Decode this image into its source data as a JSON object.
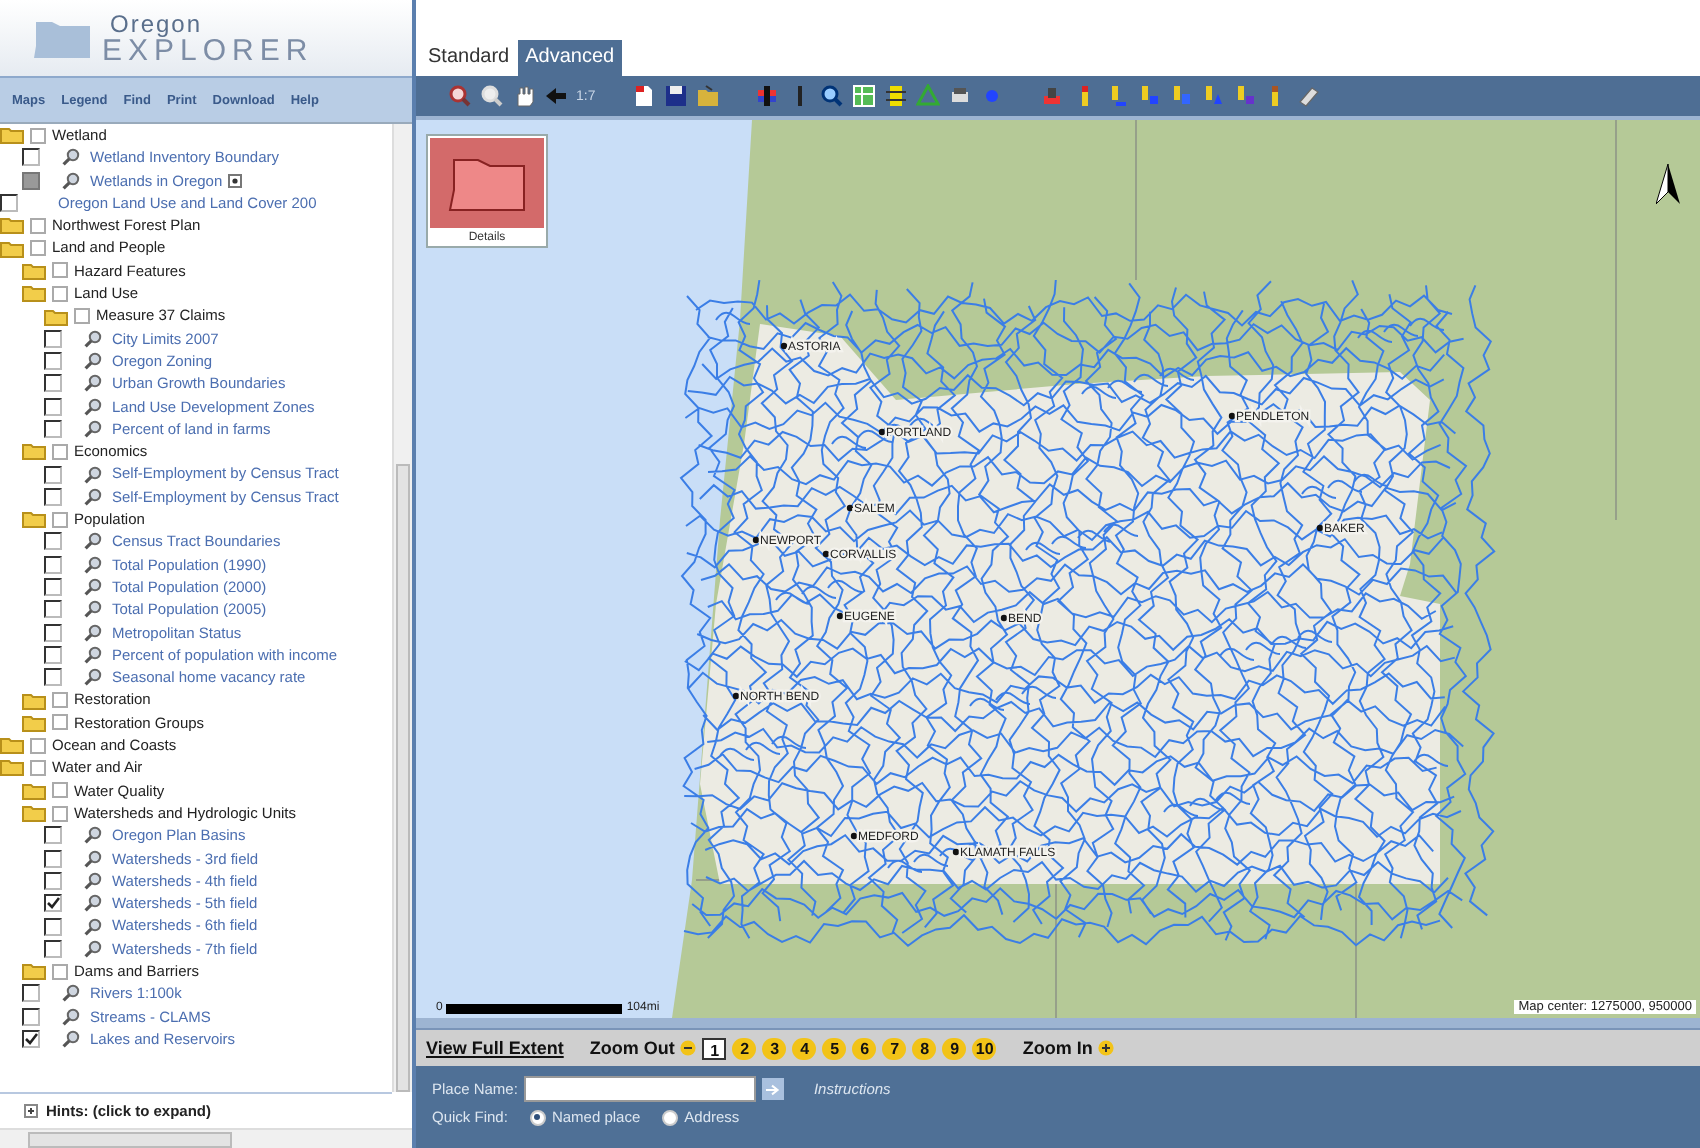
{
  "logo": {
    "line1": "Oregon",
    "line2": "EXPLORER"
  },
  "menu": [
    "Maps",
    "Legend",
    "Find",
    "Print",
    "Download",
    "Help"
  ],
  "tree": [
    {
      "kind": "folder",
      "label": "Wetland",
      "checked": false,
      "children": [
        {
          "kind": "layer",
          "label": "Wetland Inventory Boundary",
          "checked": false,
          "disabled": false
        },
        {
          "kind": "layer",
          "label": "Wetlands in Oregon",
          "checked": false,
          "disabled": true,
          "legend_button": true
        }
      ]
    },
    {
      "kind": "raster",
      "label": "Oregon Land Use and Land Cover 200",
      "checked": false,
      "disabled": false
    },
    {
      "kind": "folder",
      "label": "Northwest Forest Plan",
      "checked": false
    },
    {
      "kind": "folder",
      "label": "Land and People",
      "checked": false,
      "children": [
        {
          "kind": "folder",
          "label": "Hazard Features",
          "checked": false
        },
        {
          "kind": "folder",
          "label": "Land Use",
          "checked": false,
          "children": [
            {
              "kind": "folder",
              "label": "Measure 37 Claims",
              "checked": false
            },
            {
              "kind": "layer",
              "label": "City Limits 2007",
              "checked": false,
              "disabled": false
            },
            {
              "kind": "layer",
              "label": "Oregon Zoning",
              "checked": false,
              "disabled": false
            },
            {
              "kind": "layer",
              "label": "Urban Growth Boundaries",
              "checked": false,
              "disabled": false
            },
            {
              "kind": "layer",
              "label": "Land Use Development Zones",
              "checked": false,
              "disabled": false
            },
            {
              "kind": "layer",
              "label": "Percent of land in farms",
              "checked": false,
              "disabled": false
            }
          ]
        },
        {
          "kind": "folder",
          "label": "Economics",
          "checked": false,
          "children": [
            {
              "kind": "layer",
              "label": "Self-Employment by Census Tract",
              "checked": false,
              "disabled": false
            },
            {
              "kind": "layer",
              "label": "Self-Employment by Census Tract",
              "checked": false,
              "disabled": false
            }
          ]
        },
        {
          "kind": "folder",
          "label": "Population",
          "checked": false,
          "children": [
            {
              "kind": "layer",
              "label": "Census Tract Boundaries",
              "checked": false,
              "disabled": false
            },
            {
              "kind": "layer",
              "label": "Total Population (1990)",
              "checked": false,
              "disabled": false
            },
            {
              "kind": "layer",
              "label": "Total Population (2000)",
              "checked": false,
              "disabled": false
            },
            {
              "kind": "layer",
              "label": "Total Population (2005)",
              "checked": false,
              "disabled": false
            },
            {
              "kind": "layer",
              "label": "Metropolitan Status",
              "checked": false,
              "disabled": false
            },
            {
              "kind": "layer",
              "label": "Percent of population with income",
              "checked": false,
              "disabled": false
            },
            {
              "kind": "layer",
              "label": "Seasonal home vacancy rate",
              "checked": false,
              "disabled": false
            }
          ]
        },
        {
          "kind": "folder",
          "label": "Restoration",
          "checked": false
        },
        {
          "kind": "folder",
          "label": "Restoration Groups",
          "checked": false
        }
      ]
    },
    {
      "kind": "folder",
      "label": "Ocean and Coasts",
      "checked": false
    },
    {
      "kind": "folder",
      "label": "Water and Air",
      "checked": false,
      "children": [
        {
          "kind": "folder",
          "label": "Water Quality",
          "checked": false
        },
        {
          "kind": "folder",
          "label": "Watersheds and Hydrologic Units",
          "checked": false,
          "children": [
            {
              "kind": "layer",
              "label": "Oregon Plan Basins",
              "checked": false,
              "disabled": false
            },
            {
              "kind": "layer",
              "label": "Watersheds - 3rd field",
              "checked": false,
              "disabled": false
            },
            {
              "kind": "layer",
              "label": "Watersheds - 4th field",
              "checked": false,
              "disabled": false
            },
            {
              "kind": "layer",
              "label": "Watersheds - 5th field",
              "checked": true,
              "disabled": false
            },
            {
              "kind": "layer",
              "label": "Watersheds - 6th field",
              "checked": false,
              "disabled": false
            },
            {
              "kind": "layer",
              "label": "Watersheds - 7th field",
              "checked": false,
              "disabled": false
            }
          ]
        },
        {
          "kind": "folder",
          "label": "Dams and Barriers",
          "checked": false
        },
        {
          "kind": "layer",
          "label": "Rivers 1:100k",
          "checked": false,
          "disabled": false
        },
        {
          "kind": "layer",
          "label": "Streams - CLAMS",
          "checked": false,
          "disabled": false
        },
        {
          "kind": "layer",
          "label": "Lakes and Reservoirs",
          "checked": true,
          "disabled": false
        }
      ]
    }
  ],
  "hints": "Hints: (click to expand)",
  "tabs": [
    {
      "label": "Standard",
      "selected": false
    },
    {
      "label": "Advanced",
      "selected": true
    }
  ],
  "toolbar": {
    "scale": "1:7"
  },
  "map": {
    "overview_label": "Details",
    "cities": [
      {
        "name": "ASTORIA"
      },
      {
        "name": "PORTLAND"
      },
      {
        "name": "PENDLETON"
      },
      {
        "name": "SALEM"
      },
      {
        "name": "NEWPORT"
      },
      {
        "name": "CORVALLIS"
      },
      {
        "name": "BAKER"
      },
      {
        "name": "EUGENE"
      },
      {
        "name": "BEND"
      },
      {
        "name": "NORTH BEND"
      },
      {
        "name": "MEDFORD"
      },
      {
        "name": "KLAMATH FALLS"
      }
    ],
    "scale_start": "0",
    "scale_end": "104mi",
    "map_center": "Map center: 1275000, 950000"
  },
  "zoom_bar": {
    "full_extent": "View Full Extent",
    "zoom_out": "Zoom Out",
    "zoom_in": "Zoom In",
    "levels": [
      {
        "label": "1",
        "selected": true
      },
      {
        "label": "2",
        "selected": false
      },
      {
        "label": "3",
        "selected": false
      },
      {
        "label": "4",
        "selected": false
      },
      {
        "label": "5",
        "selected": false
      },
      {
        "label": "6",
        "selected": false
      },
      {
        "label": "7",
        "selected": false
      },
      {
        "label": "8",
        "selected": false
      },
      {
        "label": "9",
        "selected": false
      },
      {
        "label": "10",
        "selected": false
      }
    ]
  },
  "find": {
    "place_label": "Place Name:",
    "instructions": "Instructions",
    "quick_label": "Quick Find:",
    "options": [
      {
        "label": "Named place",
        "selected": true
      },
      {
        "label": "Address",
        "selected": false
      }
    ]
  }
}
